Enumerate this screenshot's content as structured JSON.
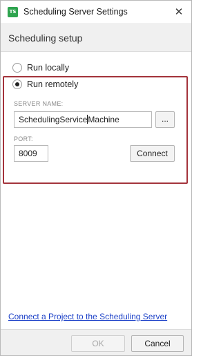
{
  "window": {
    "title": "Scheduling Server Settings",
    "app_icon_text": "TS",
    "close_glyph": "✕"
  },
  "header": {
    "title": "Scheduling setup"
  },
  "mode": {
    "options": [
      {
        "label": "Run locally",
        "selected": false
      },
      {
        "label": "Run remotely",
        "selected": true
      }
    ]
  },
  "server": {
    "name_label": "SERVER NAME:",
    "name_value_before_caret": "SchedulingService",
    "name_value_after_caret": "Machine",
    "browse_label": "...",
    "port_label": "PORT:",
    "port_value": "8009",
    "connect_label": "Connect"
  },
  "link": {
    "text": "Connect a Project to the Scheduling Server"
  },
  "footer": {
    "ok_label": "OK",
    "ok_enabled": false,
    "cancel_label": "Cancel"
  },
  "colors": {
    "highlight_border": "#a3333b",
    "link": "#1a3fc7",
    "app_icon": "#2ea44f"
  }
}
